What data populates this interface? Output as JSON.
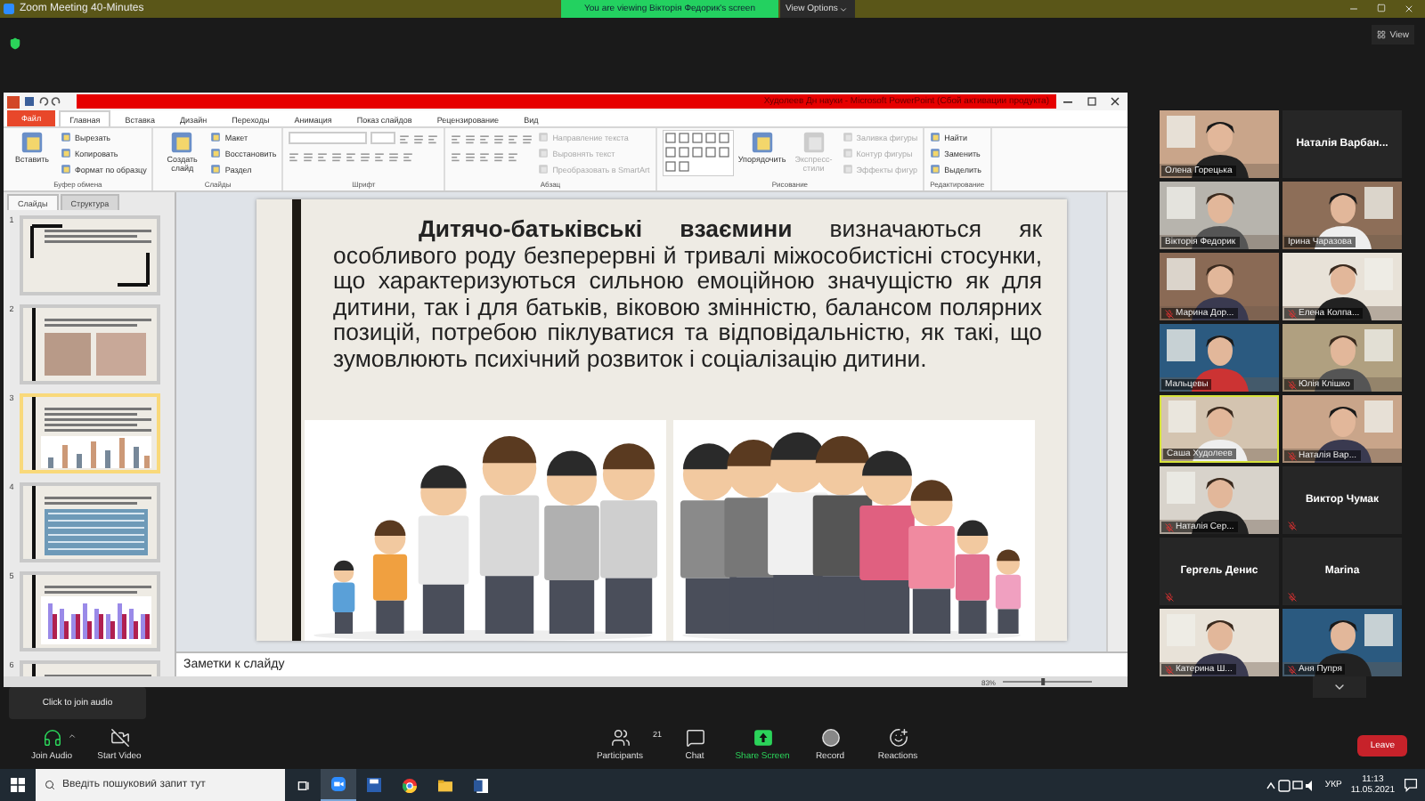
{
  "zoom": {
    "title": "Zoom Meeting 40-Minutes",
    "share_banner": "You are viewing Вікторія Федорик's screen",
    "view_options": "View Options",
    "view_button": "View",
    "tooltip": "Click to join audio"
  },
  "powerpoint": {
    "title": "Худолеев Дн науки  -  Microsoft PowerPoint (Сбой активации продукта)",
    "file_tab": "Файл",
    "tabs": [
      {
        "label": "Главная",
        "selected": true
      },
      {
        "label": "Вставка",
        "selected": false
      },
      {
        "label": "Дизайн",
        "selected": false
      },
      {
        "label": "Переходы",
        "selected": false
      },
      {
        "label": "Анимация",
        "selected": false
      },
      {
        "label": "Показ слайдов",
        "selected": false
      },
      {
        "label": "Рецензирование",
        "selected": false
      },
      {
        "label": "Вид",
        "selected": false
      }
    ],
    "groups": [
      {
        "label": "Буфер обмена",
        "kind": "commands",
        "items": [
          {
            "kind": "large",
            "label": "Вставить",
            "disabled": false
          },
          {
            "kind": "small",
            "label": "Вырезать",
            "disabled": false
          },
          {
            "kind": "small",
            "label": "Копировать",
            "disabled": false
          },
          {
            "kind": "small",
            "label": "Формат по образцу",
            "disabled": false
          }
        ]
      },
      {
        "label": "Слайды",
        "kind": "commands",
        "items": [
          {
            "kind": "large",
            "label": "Создать слайд",
            "disabled": false
          },
          {
            "kind": "small",
            "label": "Макет",
            "disabled": false
          },
          {
            "kind": "small",
            "label": "Восстановить",
            "disabled": false
          },
          {
            "kind": "small",
            "label": "Раздел",
            "disabled": false
          }
        ]
      },
      {
        "label": "Шрифт",
        "kind": "font"
      },
      {
        "label": "Абзац",
        "kind": "paragraph",
        "items": [
          {
            "kind": "small",
            "label": "Направление текста",
            "disabled": true
          },
          {
            "kind": "small",
            "label": "Выровнять текст",
            "disabled": true
          },
          {
            "kind": "small",
            "label": "Преобразовать в SmartArt",
            "disabled": true
          }
        ]
      },
      {
        "label": "Рисование",
        "kind": "drawing",
        "items": [
          {
            "kind": "large",
            "label": "Упорядочить",
            "disabled": false
          },
          {
            "kind": "large",
            "label": "Экспресс-стили",
            "disabled": true
          },
          {
            "kind": "small",
            "label": "Заливка фигуры",
            "disabled": true
          },
          {
            "kind": "small",
            "label": "Контур фигуры",
            "disabled": true
          },
          {
            "kind": "small",
            "label": "Эффекты фигур",
            "disabled": true
          }
        ]
      },
      {
        "label": "Редактирование",
        "kind": "commands",
        "items": [
          {
            "kind": "small",
            "label": "Найти",
            "disabled": false
          },
          {
            "kind": "small",
            "label": "Заменить",
            "disabled": false
          },
          {
            "kind": "small",
            "label": "Выделить",
            "disabled": false
          }
        ]
      }
    ],
    "pane_tabs": [
      {
        "label": "Слайды",
        "selected": true
      },
      {
        "label": "Структура",
        "selected": false
      }
    ],
    "slides": [
      {
        "number": "1",
        "selected": false
      },
      {
        "number": "2",
        "selected": false
      },
      {
        "number": "3",
        "selected": true
      },
      {
        "number": "4",
        "selected": false
      },
      {
        "number": "5",
        "selected": false
      },
      {
        "number": "6",
        "selected": false
      }
    ],
    "slide_text": "**Дитячо-батьківські взаємини** визначаються як особливого роду безперервні й тривалі міжособистісні стосунки, що характеризуються сильною емоційною значущістю як для дитини, так і для батьків, віковою змінністю, балансом полярних позицій, потребою піклуватися та відповідальністю, як такі, що зумовлюють психічний розвиток і соціалізацію дитини.",
    "notes": "Заметки к слайду",
    "zoom_level": "83%",
    "zoom_slider": {
      "level": 0.45
    }
  },
  "participants": [
    {
      "name": "Олена Горецька",
      "video": true,
      "muted": false,
      "speaking": false
    },
    {
      "name": "Наталія Варбан...",
      "video": false,
      "muted": false,
      "speaking": false
    },
    {
      "name": "Вікторія Федорик",
      "video": true,
      "muted": false,
      "speaking": false
    },
    {
      "name": "Ірина Чаразова",
      "video": true,
      "muted": false,
      "speaking": false
    },
    {
      "name": "Марина Дор...",
      "video": true,
      "muted": true,
      "speaking": false
    },
    {
      "name": "Елена Колпа...",
      "video": true,
      "muted": true,
      "speaking": false
    },
    {
      "name": "Мальцевы",
      "video": true,
      "muted": false,
      "speaking": false
    },
    {
      "name": "Юлія Клішко",
      "video": true,
      "muted": true,
      "speaking": false
    },
    {
      "name": "Саша Худолеев",
      "video": true,
      "muted": false,
      "speaking": true
    },
    {
      "name": "Наталія Вар...",
      "video": true,
      "muted": true,
      "speaking": false
    },
    {
      "name": "Наталія Сер...",
      "video": true,
      "muted": true,
      "speaking": false
    },
    {
      "name": "Виктор Чумак",
      "video": false,
      "muted": true,
      "speaking": false
    },
    {
      "name": "Гергель Денис",
      "video": false,
      "muted": true,
      "speaking": false
    },
    {
      "name": "Marina",
      "video": false,
      "muted": true,
      "speaking": false
    },
    {
      "name": "Катерина Ш...",
      "video": true,
      "muted": true,
      "speaking": false
    },
    {
      "name": "Аня Пупря",
      "video": true,
      "muted": true,
      "speaking": false
    }
  ],
  "toolbar": {
    "left": [
      {
        "label": "Join Audio",
        "kind": "audio"
      },
      {
        "label": "Start Video",
        "kind": "video"
      }
    ],
    "center": [
      {
        "label": "Participants",
        "kind": "participants"
      },
      {
        "label": "Chat",
        "kind": "chat"
      },
      {
        "label": "Share Screen",
        "kind": "share"
      },
      {
        "label": "Record",
        "kind": "record"
      },
      {
        "label": "Reactions",
        "kind": "reactions"
      }
    ],
    "participants_count": "21",
    "leave": "Leave"
  },
  "taskbar": {
    "search_placeholder": "Введіть пошуковий запит тут",
    "language": "УКР",
    "time": "11:13",
    "date": "11.05.2021"
  }
}
